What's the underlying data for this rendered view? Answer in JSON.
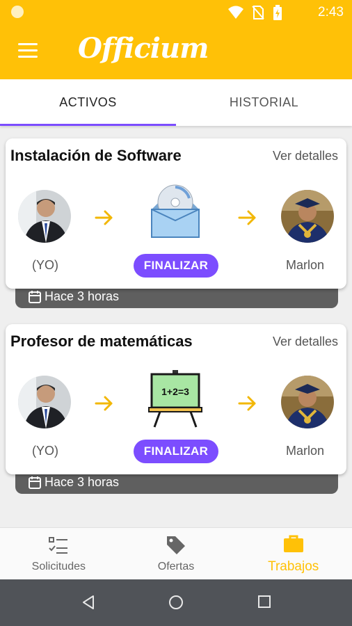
{
  "status_bar": {
    "time": "2:43"
  },
  "app_bar": {
    "logo_text": "Officium",
    "menu_icon": "hamburger-menu-icon"
  },
  "tabs": [
    {
      "label": "ACTIVOS",
      "active": true
    },
    {
      "label": "HISTORIAL",
      "active": false
    }
  ],
  "jobs": [
    {
      "title": "Instalación de Software",
      "details_label": "Ver detalles",
      "from_label": "(YO)",
      "to_label": "Marlon",
      "action_label": "FINALIZAR",
      "timestamp": "Hace 3 horas",
      "illustration": "software-box-icon"
    },
    {
      "title": "Profesor de matemáticas",
      "details_label": "Ver detalles",
      "from_label": "(YO)",
      "to_label": "Marlon",
      "action_label": "FINALIZAR",
      "timestamp": "Hace 3 horas",
      "illustration": "chalkboard-icon",
      "chalkboard_text": "1+2=3"
    }
  ],
  "bottom_nav": [
    {
      "label": "Solicitudes",
      "icon": "checklist-icon",
      "active": false
    },
    {
      "label": "Ofertas",
      "icon": "tag-icon",
      "active": false
    },
    {
      "label": "Trabajos",
      "icon": "briefcase-icon",
      "active": true
    }
  ],
  "colors": {
    "primary": "#ffc107",
    "accent": "#7c4dff",
    "arrow": "#f2b705",
    "timestamp_bar": "#5f5f5f",
    "system_nav": "#505358"
  }
}
